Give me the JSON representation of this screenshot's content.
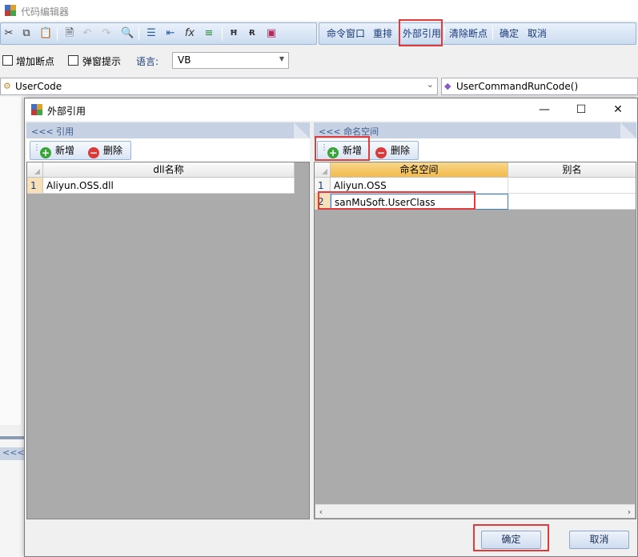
{
  "app": {
    "title": "代码编辑器"
  },
  "toolbar": {
    "icons": [
      "cut-icon",
      "copy-icon",
      "paste-icon",
      "document-icon",
      "undo-icon",
      "redo-icon",
      "find-icon",
      "indent-icon",
      "outdent-icon",
      "function-icon",
      "list-icon",
      "comment-icon",
      "uncomment-icon",
      "save-icon"
    ],
    "commands": [
      "命令窗口",
      "重排",
      "外部引用",
      "清除断点",
      "确定",
      "取消"
    ]
  },
  "options": {
    "add_breakpoint": "增加断点",
    "popup_hint": "弹窗提示",
    "language_label": "语言:",
    "language_value": "VB"
  },
  "code_nav": {
    "class_combo": "UserCode",
    "method_combo": "UserCommandRunCode()"
  },
  "bottom_panel": {
    "label": "<<<"
  },
  "dialog": {
    "title": "外部引用",
    "left_pane": {
      "header": "<<< 引用",
      "add_label": "新增",
      "delete_label": "删除",
      "column": "dll名称",
      "rows": [
        {
          "num": "1",
          "name": "Aliyun.OSS.dll"
        }
      ]
    },
    "right_pane": {
      "header": "<<< 命名空间",
      "add_label": "新增",
      "delete_label": "删除",
      "columns": [
        "命名空间",
        "别名"
      ],
      "rows": [
        {
          "num": "1",
          "namespace": "Aliyun.OSS",
          "alias": ""
        },
        {
          "num": "2",
          "namespace": "sanMuSoft.UserClass",
          "alias": ""
        }
      ]
    },
    "ok_label": "确定",
    "cancel_label": "取消"
  },
  "colors": {
    "highlight": "#e23b3b",
    "accent": "#1a3a78"
  }
}
